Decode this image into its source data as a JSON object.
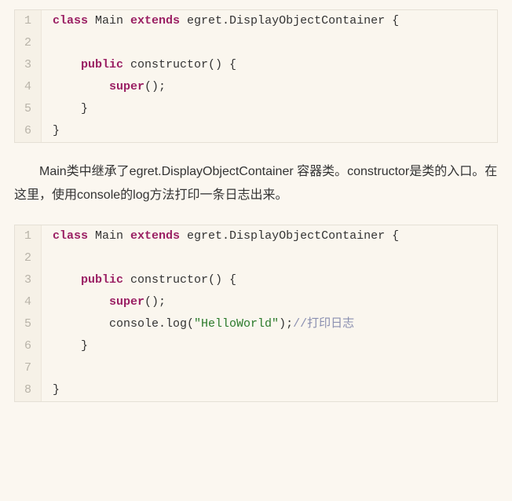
{
  "block1": {
    "lines": [
      {
        "n": "1",
        "tokens": [
          {
            "t": "class ",
            "c": "kw"
          },
          {
            "t": "Main ",
            "c": ""
          },
          {
            "t": "extends ",
            "c": "kw"
          },
          {
            "t": "egret.DisplayObjectContainer {",
            "c": ""
          }
        ]
      },
      {
        "n": "2",
        "tokens": []
      },
      {
        "n": "3",
        "tokens": [
          {
            "t": "    ",
            "c": ""
          },
          {
            "t": "public ",
            "c": "kw"
          },
          {
            "t": "constructor() {",
            "c": ""
          }
        ]
      },
      {
        "n": "4",
        "tokens": [
          {
            "t": "        ",
            "c": ""
          },
          {
            "t": "super",
            "c": "kw"
          },
          {
            "t": "();",
            "c": ""
          }
        ]
      },
      {
        "n": "5",
        "tokens": [
          {
            "t": "    }",
            "c": ""
          }
        ]
      },
      {
        "n": "6",
        "tokens": [
          {
            "t": "}",
            "c": ""
          }
        ]
      }
    ]
  },
  "paragraph": "Main类中继承了egret.DisplayObjectContainer 容器类。constructor是类的入口。在这里，使用console的log方法打印一条日志出来。",
  "block2": {
    "lines": [
      {
        "n": "1",
        "tokens": [
          {
            "t": "class ",
            "c": "kw"
          },
          {
            "t": "Main ",
            "c": ""
          },
          {
            "t": "extends ",
            "c": "kw"
          },
          {
            "t": "egret.DisplayObjectContainer {",
            "c": ""
          }
        ]
      },
      {
        "n": "2",
        "tokens": []
      },
      {
        "n": "3",
        "tokens": [
          {
            "t": "    ",
            "c": ""
          },
          {
            "t": "public ",
            "c": "kw"
          },
          {
            "t": "constructor() {",
            "c": ""
          }
        ]
      },
      {
        "n": "4",
        "tokens": [
          {
            "t": "        ",
            "c": ""
          },
          {
            "t": "super",
            "c": "kw"
          },
          {
            "t": "();",
            "c": ""
          }
        ]
      },
      {
        "n": "5",
        "tokens": [
          {
            "t": "        console.log(",
            "c": ""
          },
          {
            "t": "\"HelloWorld\"",
            "c": "str"
          },
          {
            "t": ");",
            "c": ""
          },
          {
            "t": "//打印日志",
            "c": "cmt"
          }
        ]
      },
      {
        "n": "6",
        "tokens": [
          {
            "t": "    }",
            "c": ""
          }
        ]
      },
      {
        "n": "7",
        "tokens": []
      },
      {
        "n": "8",
        "tokens": [
          {
            "t": "}",
            "c": ""
          }
        ]
      }
    ]
  }
}
